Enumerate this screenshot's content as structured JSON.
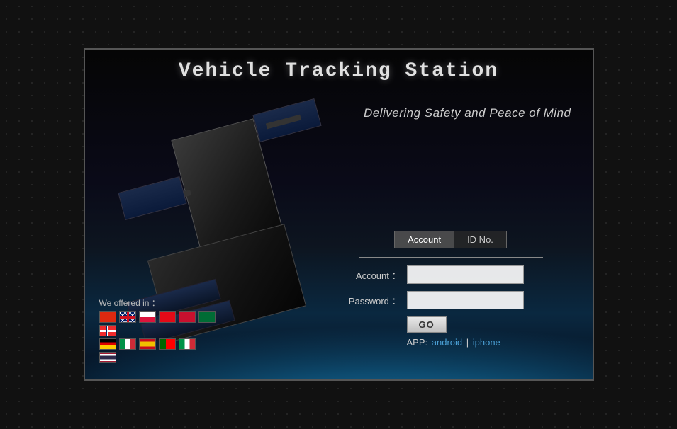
{
  "app": {
    "title": "Vehicle Tracking Station",
    "subtitle": "Delivering Safety and Peace of Mind"
  },
  "tabs": [
    {
      "id": "account",
      "label": "Account",
      "active": true
    },
    {
      "id": "idno",
      "label": "ID No.",
      "active": false
    }
  ],
  "form": {
    "account_label": "Account ：",
    "password_label": "Password ：",
    "account_value": "",
    "password_value": "",
    "submit_label": "GO"
  },
  "app_links": {
    "prefix": "APP:",
    "android_label": "android",
    "iphone_label": "iphone"
  },
  "languages": {
    "label": "We offered in ：",
    "flags": [
      {
        "name": "Chinese",
        "code": "cn"
      },
      {
        "name": "English",
        "code": "gb"
      },
      {
        "name": "Polish",
        "code": "pl"
      },
      {
        "name": "Turkish",
        "code": "tr"
      },
      {
        "name": "Arabic-red",
        "code": "tur2"
      },
      {
        "name": "Saudi Arabia",
        "code": "sa"
      },
      {
        "name": "Norwegian",
        "code": "no"
      },
      {
        "name": "German",
        "code": "de"
      },
      {
        "name": "Italian2",
        "code": "it2"
      },
      {
        "name": "Spanish",
        "code": "es"
      },
      {
        "name": "Portuguese",
        "code": "pt"
      },
      {
        "name": "Italian",
        "code": "it"
      },
      {
        "name": "Thai",
        "code": "th"
      }
    ]
  }
}
